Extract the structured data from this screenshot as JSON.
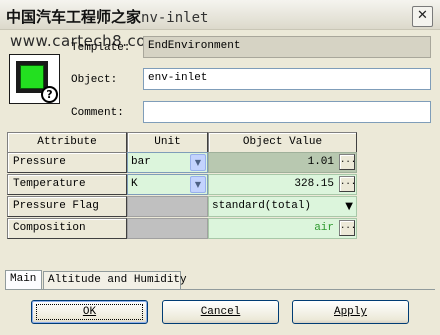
{
  "window": {
    "title_prefix": "中国汽车工程师之家",
    "title_suffix": "nv-inlet",
    "watermark": "www.cartech8.com",
    "close_glyph": "✕"
  },
  "header": {
    "template_label": "Template:",
    "template_value": "EndEnvironment",
    "object_label": "Object:",
    "object_value": "env-inlet",
    "comment_label": "Comment:",
    "comment_value": ""
  },
  "table": {
    "columns": [
      "Attribute",
      "Unit",
      "Object Value"
    ],
    "rows": [
      {
        "attribute": "Pressure",
        "unit": "bar",
        "value": "1.01"
      },
      {
        "attribute": "Temperature",
        "unit": "K",
        "value": "328.15"
      },
      {
        "attribute": "Pressure Flag",
        "unit": "",
        "value": "standard(total)"
      },
      {
        "attribute": "Composition",
        "unit": "",
        "value": "air"
      }
    ],
    "ellipsis": "..."
  },
  "tabs": [
    "Main",
    "Altitude and Humidity"
  ],
  "buttons": {
    "ok": "OK",
    "cancel": "Cancel",
    "apply": "Apply"
  },
  "colors": {
    "composition_value": "#2f9a2f"
  }
}
